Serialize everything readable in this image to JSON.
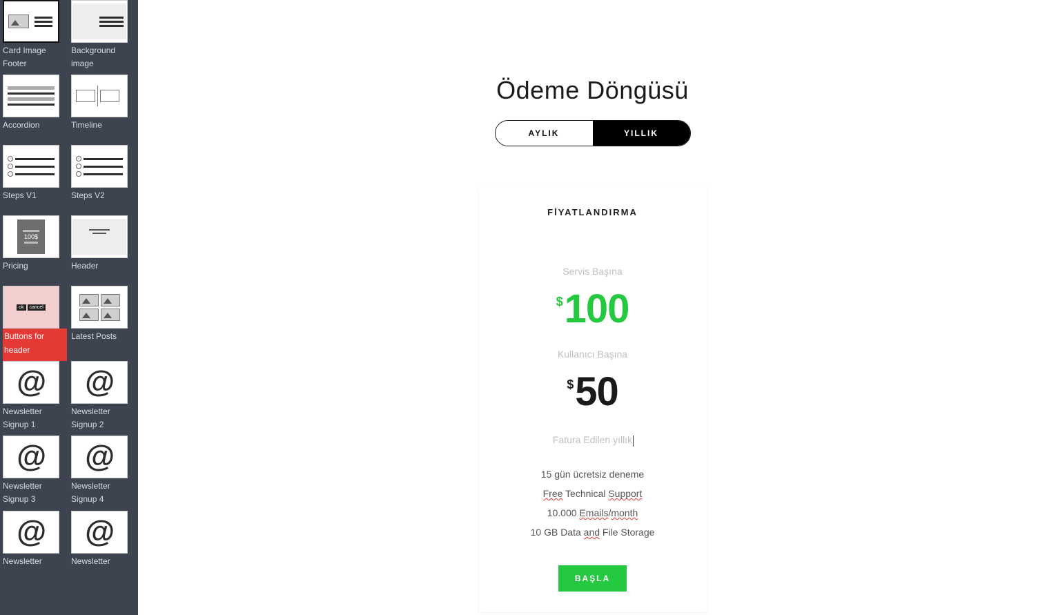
{
  "sidebar": {
    "tiles": [
      {
        "label": "Card Image Footer",
        "kind": "cardimg"
      },
      {
        "label": "Background image",
        "kind": "bgimg"
      },
      {
        "label": "Accordion",
        "kind": "accordion"
      },
      {
        "label": "Timeline",
        "kind": "timeline"
      },
      {
        "label": "Steps V1",
        "kind": "steps1"
      },
      {
        "label": "Steps V2",
        "kind": "steps2"
      },
      {
        "label": "Pricing",
        "kind": "pricing"
      },
      {
        "label": "Header",
        "kind": "header"
      },
      {
        "label": "Buttons for header",
        "kind": "buttons"
      },
      {
        "label": "Latest Posts",
        "kind": "posts"
      },
      {
        "label": "Newsletter Signup 1",
        "kind": "at"
      },
      {
        "label": "Newsletter Signup 2",
        "kind": "at"
      },
      {
        "label": "Newsletter Signup 3",
        "kind": "at"
      },
      {
        "label": "Newsletter Signup 4",
        "kind": "at"
      },
      {
        "label": "Newsletter",
        "kind": "at"
      },
      {
        "label": "Newsletter",
        "kind": "at"
      }
    ]
  },
  "page": {
    "cycle_title": "Ödeme Döngüsü",
    "toggle": {
      "monthly": "AYLIK",
      "yearly": "YILLIK",
      "selected": "yearly"
    },
    "card": {
      "heading": "FİYATLANDIRMA",
      "per_service_label": "Servis Başına",
      "per_service_currency": "$",
      "per_service_price": "100",
      "per_user_label": "Kullanıcı Başına",
      "per_user_currency": "$",
      "per_user_price": "50",
      "billing_note": "Fatura Edilen yıllık",
      "features": [
        {
          "text": "15 gün ücretsiz deneme",
          "red_spans": []
        },
        {
          "text": "Free Technical Support",
          "red_spans": [
            "Free",
            "Support"
          ]
        },
        {
          "text": "10.000 Emails/month",
          "red_spans": [
            "Emails",
            "month"
          ]
        },
        {
          "text": "10 GB Data and File Storage",
          "red_spans": [
            "and"
          ]
        }
      ],
      "cta": "BAŞLA"
    }
  },
  "colors": {
    "accent_green": "#25c93f",
    "sidebar_bg": "#3d4450",
    "danger": "#e53935"
  }
}
